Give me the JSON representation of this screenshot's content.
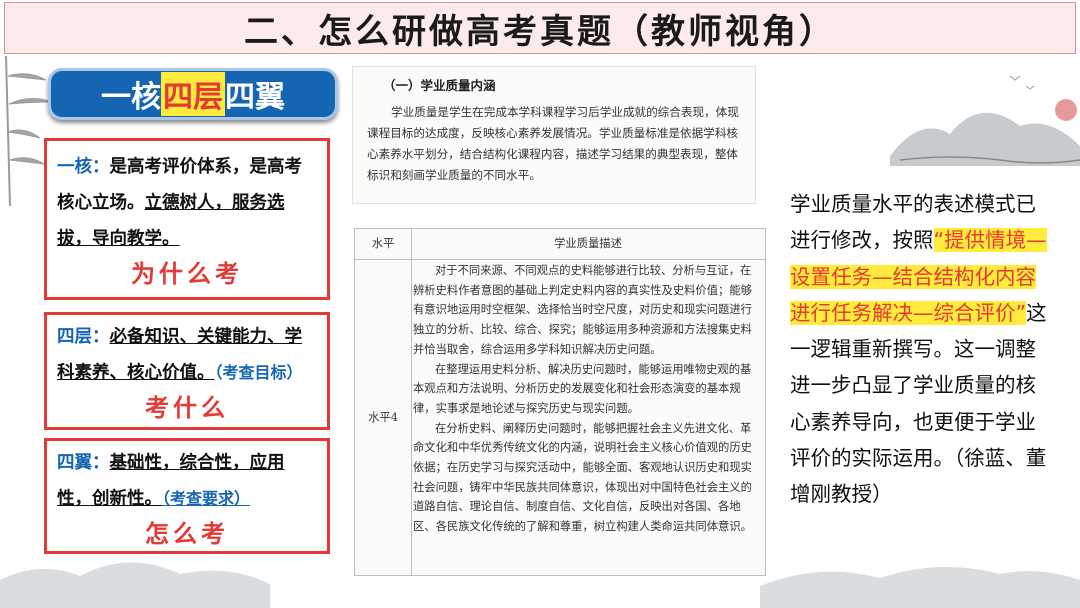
{
  "title": "二、怎么研做高考真题（教师视角）",
  "badge": {
    "part1": "一核",
    "part2": "四层",
    "part3": "四翼"
  },
  "boxes": {
    "core": {
      "head": "一核：",
      "text1": "是高考评价体系，是高考核心立场。",
      "text2": "立德树人，服务选拔，导向教学。",
      "tag": "为什么考"
    },
    "layers": {
      "head": "四层：",
      "text1": "必备知识、关键能力、学科素养、核心价值。",
      "note": "（考查目标）",
      "tag": "考什么"
    },
    "wings": {
      "head": "四翼：",
      "text1": "基础性，综合性，应用性，创新性。",
      "note": "（考查要求）",
      "tag": "怎么考"
    }
  },
  "doc": {
    "heading": "（一）学业质量内涵",
    "paragraph": "学业质量是学生在完成本学科课程学习后学业成就的综合表现，体现课程目标的达成度，反映核心素养发展情况。学业质量标准是依据学科核心素养水平划分，结合结构化课程内容，描述学习结果的典型表现，整体标识和刻画学业质量的不同水平。"
  },
  "table": {
    "col_level": "水平",
    "col_desc": "学业质量描述",
    "level": "水平4",
    "paragraphs": [
      "对于不同来源、不同观点的史料能够进行比较、分析与互证，在辨析史料作者意图的基础上判定史料内容的真实性及史料价值；能够有意识地运用时空框架、选择恰当时空尺度，对历史和现实问题进行独立的分析、比较、综合、探究；能够运用多种资源和方法搜集史料并恰当取舍，综合运用多学科知识解决历史问题。",
      "在整理运用史料分析、解决历史问题时，能够运用唯物史观的基本观点和方法说明、分析历史的发展变化和社会形态演变的基本规律，实事求是地论述与探究历史与现实问题。",
      "在分析史料、阐释历史问题时，能够把握社会主义先进文化、革命文化和中华优秀传统文化的内涵，说明社会主义核心价值观的历史依据；在历史学习与探究活动中，能够全面、客观地认识历史和现实社会问题，铸牢中华民族共同体意识，体现出对中国特色社会主义的道路自信、理论自信、制度自信、文化自信，反映出对各国、各地区、各民族文化传统的了解和尊重，树立构建人类命运共同体意识。"
    ]
  },
  "right": {
    "pre": "学业质量水平的表述模式已进行修改，按照",
    "highlight": "“提供情境—设置任务—结合结构化内容进行任务解决—综合评价”",
    "post": "这一逻辑重新撰写。这一调整进一步凸显了学业质量的核心素养导向，也更便于学业评价的实际运用。（徐蓝、董增刚教授）"
  },
  "colors": {
    "accent_red": "#e53935",
    "accent_blue": "#1565b3",
    "highlight": "#ffeb3b"
  }
}
